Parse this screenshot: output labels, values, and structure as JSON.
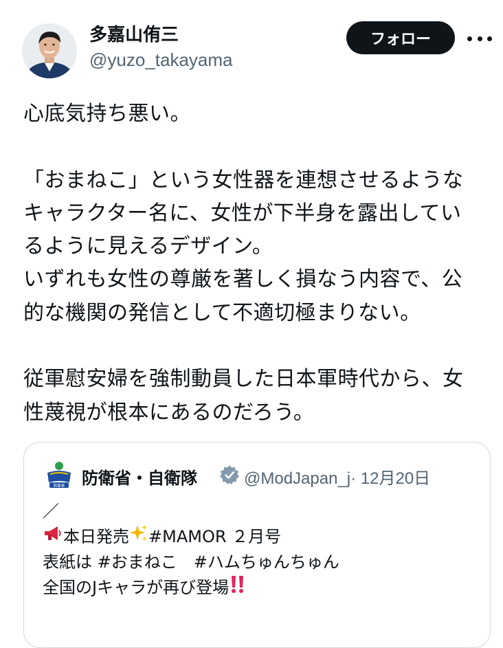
{
  "author": {
    "name": "多嘉山侑三",
    "handle": "@yuzo_takayama",
    "follow_label": "フォロー"
  },
  "post": {
    "lines": [
      "心底気持ち悪い。",
      "",
      "「おまねこ」という女性器を連想させるような",
      "キャラクター名に、女性が下半身を露出してい",
      "るように見えるデザイン。",
      "いずれも女性の尊厳を著しく損なう内容で、公",
      "的な機関の発信として不適切極まりない。",
      "",
      "従軍慰安婦を強制動員した日本軍時代から、女",
      "性蔑視が根本にあるのだろう。"
    ]
  },
  "quote": {
    "name": "防衛省・自衛隊",
    "handle": "@ModJapan_j",
    "date": "· 12月20日",
    "line1": "／",
    "line2": "本日発売",
    "line2b": " #MAMOR ２月号",
    "line3": "表紙は #おまねこ　#ハムちゅんちゅん",
    "line4": "全国のJキャラが再び登場"
  },
  "icons": {
    "more": "more-horizontal-icon",
    "verified": "gray-verified-badge-icon",
    "megaphone": "megaphone-icon",
    "sparkles": "sparkles-icon",
    "double_exclamation": "double-exclamation-icon"
  },
  "colors": {
    "follow_bg": "#0f1419",
    "secondary_text": "#536471",
    "card_border": "#cfd9de",
    "exclamation": "#e0245e"
  }
}
